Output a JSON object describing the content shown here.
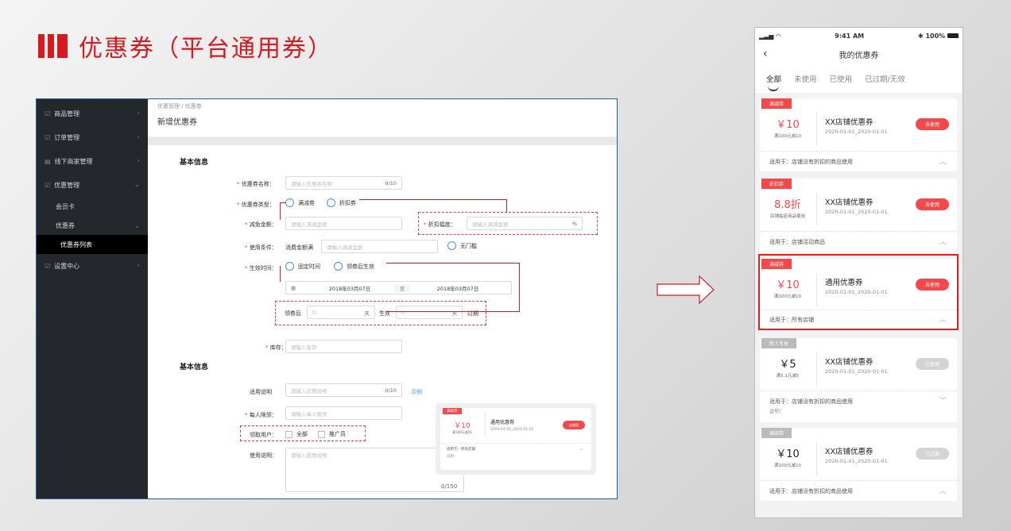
{
  "slide_title": "优惠券（平台通用券）",
  "admin": {
    "sidebar": {
      "items": [
        {
          "label": "商品管理",
          "icon": "edit-icon"
        },
        {
          "label": "订单管理",
          "icon": "edit-icon"
        },
        {
          "label": "线下商家管理",
          "icon": "table-icon"
        },
        {
          "label": "优惠管理",
          "icon": "edit-icon"
        },
        {
          "label": "设置中心",
          "icon": "edit-icon"
        }
      ],
      "sub": [
        "会员卡",
        "优惠券",
        "优惠券列表"
      ]
    },
    "breadcrumb": "优惠管理 / 优惠券",
    "page_title": "新增优惠券",
    "form": {
      "section1": "基本信息",
      "name_label": "优惠券名称：",
      "name_placeholder": "请输入优惠券名称",
      "name_count": "0/10",
      "type_label": "优惠券类型：",
      "type_opt1": "满减券",
      "type_opt2": "折扣券",
      "reduce_label": "减免金额：",
      "reduce_placeholder": "请输入满减金额",
      "discount_label": "折扣幅度：",
      "discount_placeholder": "请输入满减金额",
      "discount_unit": "%",
      "cond_label": "使用条件：",
      "cond_prefix": "消费金额满",
      "cond_placeholder": "请输入满减金额",
      "cond_none": "无门槛",
      "valid_label": "生效时间：",
      "valid_opt1": "固定时间",
      "valid_opt2": "领券后生效",
      "date_start": "2018年03月07日",
      "date_sep": "至",
      "date_end": "2018年03月07日",
      "after_prefix": "领券后",
      "after_val1": "0",
      "after_unit1": "天",
      "after_mid": "生效",
      "after_val2": "0",
      "after_unit2": "天",
      "after_suffix": "过期",
      "stock_label": "库存：",
      "stock_placeholder": "请输入库存",
      "section2": "基本信息",
      "apply_label": "适用说明",
      "apply_placeholder": "请输入适用说明",
      "apply_count": "0/10",
      "apply_example": "示例",
      "limit_label": "每人限领：",
      "limit_placeholder": "请输入每人限领",
      "users_label": "领取用户：",
      "users_opt1": "全部",
      "users_opt2": "推广员",
      "usage_label": "使用说明：",
      "usage_placeholder": "请输入使用说明",
      "usage_count": "0/150"
    },
    "preview": {
      "tag": "满减券",
      "value": "￥10",
      "desc": "满100元减10",
      "name": "通用优惠券",
      "date": "2020-01-01_2020-01-01",
      "btn": "去使用",
      "apply": "适用于：所有店铺",
      "note": "说明："
    }
  },
  "phone": {
    "time": "9:41 AM",
    "battery": "100%",
    "title": "我的优惠券",
    "tabs": [
      "全部",
      "未使用",
      "已使用",
      "已过期/无效"
    ],
    "coupons": [
      {
        "tag": "满减券",
        "value": "￥10",
        "desc": "满100元减10",
        "name": "XX店铺优惠券",
        "date": "2020-01-01_2020-01-01",
        "btn": "去使用",
        "foot": "适用于：店铺没有折扣的商品使用",
        "extra": ""
      },
      {
        "tag": "折扣券",
        "value": "8.8折",
        "desc": "店铺指定商品使用",
        "name": "XX店铺优惠券",
        "date": "2020-01-01_2020-01-01",
        "btn": "去使用",
        "foot": "适用于：店铺活动商品",
        "extra": ""
      },
      {
        "tag": "满减券",
        "value": "￥10",
        "desc": "满100元减10",
        "name": "通用优惠券",
        "date": "2020-01-01_2020-01-01",
        "btn": "去使用",
        "foot": "适用于：所有店铺",
        "extra": ""
      },
      {
        "tag": "新人专享",
        "value": "￥5",
        "desc": "满5.1元减5",
        "name": "XX店铺优惠券",
        "date": "2020-01-01_2020-01-01",
        "btn": "已使用",
        "foot": "适用于：店铺没有折扣的商品使用",
        "extra": "说明："
      },
      {
        "tag": "满减券",
        "value": "￥10",
        "desc": "满100元减10",
        "name": "XX店铺优惠券",
        "date": "2020-01-01_2020-01-01",
        "btn": "已过期",
        "foot": "适用于：店铺没有折扣的商品使用",
        "extra": ""
      }
    ]
  },
  "colors": {
    "accent": "#d71920",
    "coupon_red": "#f5484a",
    "disabled": "#cccccc",
    "link": "#4a90e2"
  }
}
